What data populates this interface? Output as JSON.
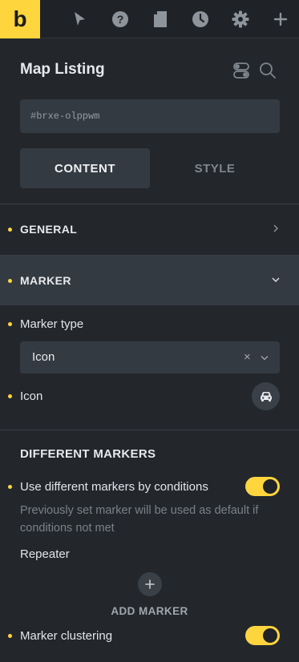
{
  "colors": {
    "accent": "#ffd53e",
    "panel": "#23272c",
    "field": "#343a41"
  },
  "topbar": {
    "logo": "b",
    "icons": [
      "cursor-icon",
      "help-icon",
      "page-icon",
      "history-icon",
      "gear-icon",
      "plus-icon"
    ]
  },
  "panel": {
    "title": "Map Listing",
    "element_id_placeholder": "#brxe-olppwm"
  },
  "tabs": {
    "content": "CONTENT",
    "style": "STYLE",
    "active": "CONTENT"
  },
  "sections": {
    "general": "GENERAL",
    "marker": "MARKER"
  },
  "marker": {
    "type_label": "Marker type",
    "type_value": "Icon",
    "clear_symbol": "×",
    "icon_label": "Icon"
  },
  "different_markers": {
    "heading": "DIFFERENT MARKERS",
    "use_conditions_label": "Use different markers by conditions",
    "use_conditions_enabled": true,
    "description": "Previously set marker will be used as default if conditions not met",
    "repeater_label": "Repeater",
    "add_label": "ADD MARKER"
  },
  "clustering": {
    "label": "Marker clustering",
    "enabled": true
  }
}
